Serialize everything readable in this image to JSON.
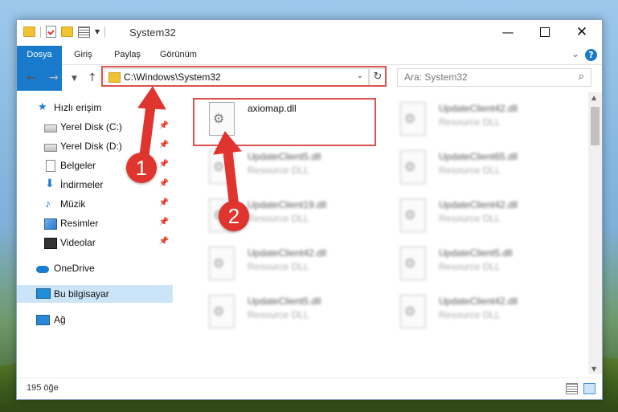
{
  "window": {
    "title": "System32",
    "controls": {
      "minimize": "—",
      "maximize": "",
      "close": "✕"
    }
  },
  "ribbon": {
    "tabs": [
      "Dosya",
      "Giriş",
      "Paylaş",
      "Görünüm"
    ],
    "help": "?"
  },
  "navigation": {
    "address": "C:\\Windows\\System32",
    "search_placeholder": "Ara: System32",
    "refresh": "↻"
  },
  "sidebar": {
    "quick_access": "Hızlı erişim",
    "items": [
      {
        "label": "Yerel Disk (C:)",
        "icon": "drive-icon"
      },
      {
        "label": "Yerel Disk (D:)",
        "icon": "drive-icon"
      },
      {
        "label": "Belgeler",
        "icon": "documents-icon"
      },
      {
        "label": "İndirmeler",
        "icon": "downloads-icon"
      },
      {
        "label": "Müzik",
        "icon": "music-icon"
      },
      {
        "label": "Resimler",
        "icon": "pictures-icon"
      },
      {
        "label": "Videolar",
        "icon": "videos-icon"
      }
    ],
    "onedrive": "OneDrive",
    "this_pc": "Bu bilgisayar",
    "network": "Ağ"
  },
  "files": [
    {
      "name": "axiomap.dll",
      "type": ""
    },
    {
      "name": "UpdateClient42.dll",
      "type": "Resource DLL"
    },
    {
      "name": "UpdateClient5.dll",
      "type": "Resource DLL"
    },
    {
      "name": "UpdateClient65.dll",
      "type": "Resource DLL"
    },
    {
      "name": "UpdateClient19.dll",
      "type": "Resource DLL"
    },
    {
      "name": "UpdateClient42.dll",
      "type": "Resource DLL"
    },
    {
      "name": "UpdateClient42.dll",
      "type": "Resource DLL"
    },
    {
      "name": "UpdateClient5.dll",
      "type": "Resource DLL"
    },
    {
      "name": "UpdateClient5.dll",
      "type": "Resource DLL"
    },
    {
      "name": "UpdateClient42.dll",
      "type": "Resource DLL"
    }
  ],
  "status": {
    "item_count": "195 öğe"
  },
  "callouts": {
    "one": "1",
    "two": "2"
  },
  "colors": {
    "accent": "#1979ca",
    "highlight": "#d9534f",
    "selection": "#cce4f7"
  }
}
